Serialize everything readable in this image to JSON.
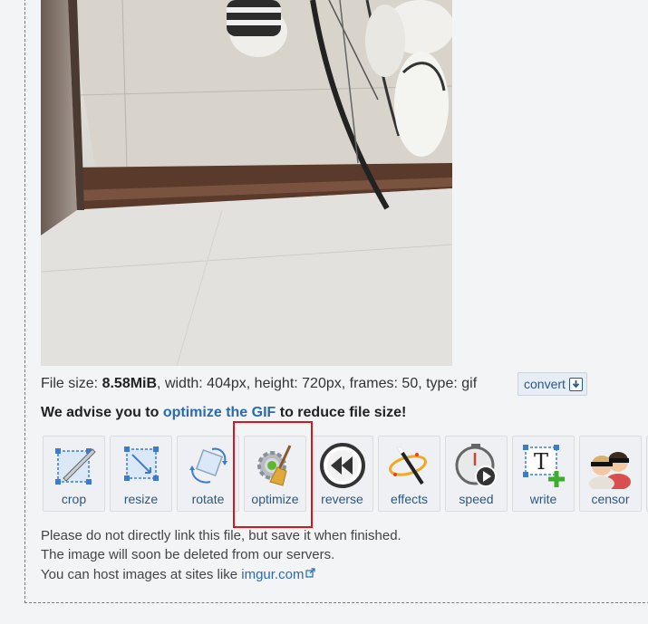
{
  "file_info": {
    "prefix": "File size: ",
    "size": "8.58MiB",
    "rest": ", width: 404px, height: 720px, frames: 50, type: gif",
    "convert_label": "convert"
  },
  "advice": {
    "before": "We advise you to ",
    "link": "optimize the GIF",
    "after": " to reduce file size!"
  },
  "tools": [
    {
      "label": "crop",
      "icon": "crop-icon"
    },
    {
      "label": "resize",
      "icon": "resize-icon"
    },
    {
      "label": "rotate",
      "icon": "rotate-icon"
    },
    {
      "label": "optimize",
      "icon": "broom-gear-icon"
    },
    {
      "label": "reverse",
      "icon": "rewind-icon"
    },
    {
      "label": "effects",
      "icon": "magic-wand-icon"
    },
    {
      "label": "speed",
      "icon": "stopwatch-icon"
    },
    {
      "label": "write",
      "icon": "text-add-icon"
    },
    {
      "label": "censor",
      "icon": "censor-faces-icon"
    }
  ],
  "notes": {
    "line1": "Please do not directly link this file, but save it when finished.",
    "line2": "The image will soon be deleted from our servers.",
    "line3_before": "You can host images at sites like ",
    "line3_link": "imgur.com"
  },
  "colors": {
    "link": "#2a6ab0",
    "highlight": "#d9161c",
    "tool_label": "#2a5885"
  }
}
